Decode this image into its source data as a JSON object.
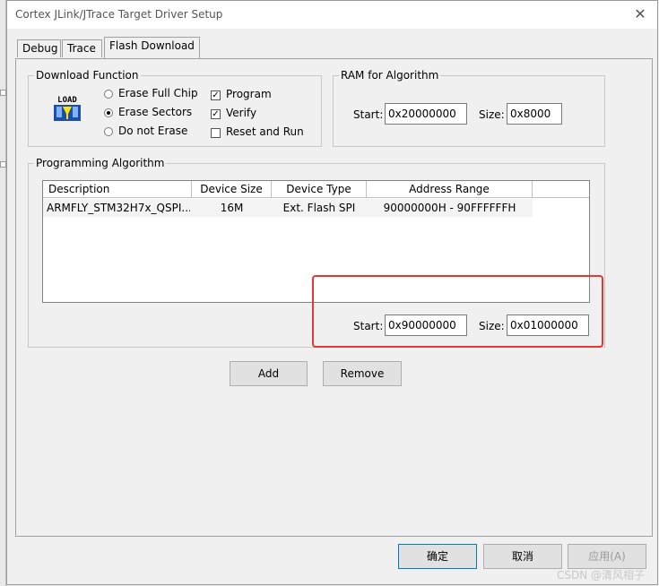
{
  "window": {
    "title": "Cortex JLink/JTrace Target Driver Setup",
    "close_glyph": "✕"
  },
  "tabs": [
    {
      "label": "Debug",
      "active": false
    },
    {
      "label": "Trace",
      "active": false
    },
    {
      "label": "Flash Download",
      "active": true
    }
  ],
  "download_function": {
    "group_label": "Download Function",
    "load_icon_text": "LOAD",
    "radios": [
      {
        "label": "Erase Full Chip",
        "selected": false
      },
      {
        "label": "Erase Sectors",
        "selected": true
      },
      {
        "label": "Do not Erase",
        "selected": false
      }
    ],
    "checks": [
      {
        "label": "Program",
        "checked": true
      },
      {
        "label": "Verify",
        "checked": true
      },
      {
        "label": "Reset and Run",
        "checked": false
      }
    ]
  },
  "ram_algorithm": {
    "group_label": "RAM for Algorithm",
    "start_label": "Start:",
    "start_value": "0x20000000",
    "size_label": "Size:",
    "size_value": "0x8000"
  },
  "programming_algorithm": {
    "group_label": "Programming Algorithm",
    "columns": [
      "Description",
      "Device Size",
      "Device Type",
      "Address Range"
    ],
    "rows": [
      {
        "description": "ARMFLY_STM32H7x_QSPI...",
        "device_size": "16M",
        "device_type": "Ext. Flash SPI",
        "address_range": "90000000H - 90FFFFFFH"
      }
    ],
    "start_label": "Start:",
    "start_value": "0x90000000",
    "size_label": "Size:",
    "size_value": "0x01000000"
  },
  "buttons": {
    "add": "Add",
    "remove": "Remove",
    "ok": "确定",
    "cancel": "取消",
    "apply": "应用(A)"
  },
  "watermark": "CSDN @清风相子",
  "colors": {
    "highlight_box": "#e53935",
    "default_button_border": "#0078d7"
  }
}
